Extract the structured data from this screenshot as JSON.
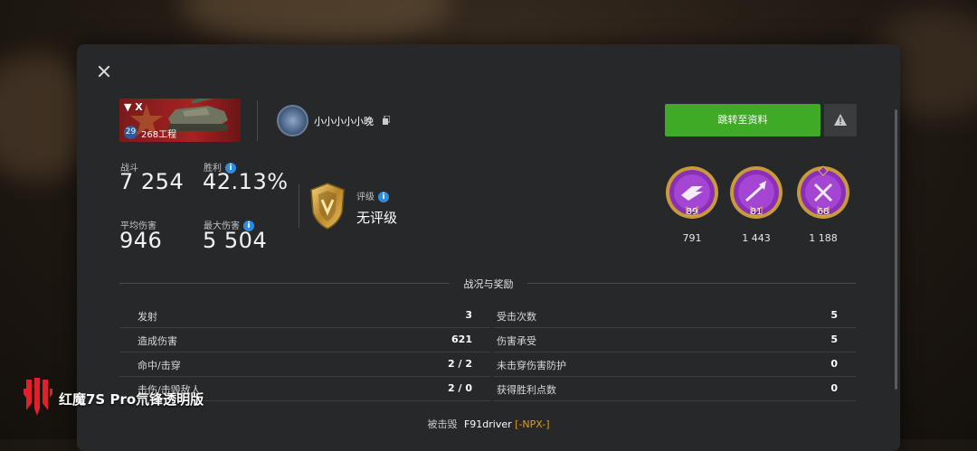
{
  "tank": {
    "tier_roman": "X",
    "level": "29",
    "name": "268工程"
  },
  "player": {
    "name": "小小小小小晚"
  },
  "actions": {
    "profile_button": "跳转至资料"
  },
  "stats": {
    "battles_label": "战斗",
    "battles_value": "7 254",
    "winrate_label": "胜利",
    "winrate_value": "42.13%",
    "avg_damage_label": "平均伤害",
    "avg_damage_value": "946",
    "max_damage_label": "最大伤害",
    "max_damage_value": "5 504"
  },
  "rating": {
    "label": "评级",
    "value": "无评级"
  },
  "medals": [
    {
      "level": "89",
      "count": "791",
      "icon": "ricochet-medal-icon"
    },
    {
      "level": "81",
      "count": "1 443",
      "icon": "arrow-hit-medal-icon"
    },
    {
      "level": "68",
      "count": "1 188",
      "icon": "crossed-tools-medal-icon"
    }
  ],
  "section": {
    "title": "战况与奖励"
  },
  "left_rows": [
    {
      "label": "发射",
      "value": "3"
    },
    {
      "label": "造成伤害",
      "value": "621"
    },
    {
      "label": "命中/击穿",
      "value": "2 / 2"
    },
    {
      "label": "击伤/击毁敌人",
      "value": "2 / 0"
    }
  ],
  "right_rows": [
    {
      "label": "受击次数",
      "value": "5"
    },
    {
      "label": "伤害承受",
      "value": "5"
    },
    {
      "label": "未击穿伤害防护",
      "value": "0"
    },
    {
      "label": "获得胜利点数",
      "value": "0"
    }
  ],
  "footer": {
    "prefix": "被击毁",
    "killer": "F91driver",
    "clan": "[-NPX-]"
  },
  "watermark": {
    "text": "红魔7S Pro氘锋透明版"
  },
  "colors": {
    "accent_green": "#3faa26",
    "clan_orange": "#e59a2a",
    "info_blue": "#2e8ce0",
    "medal_purple": "#8a2fb8"
  }
}
